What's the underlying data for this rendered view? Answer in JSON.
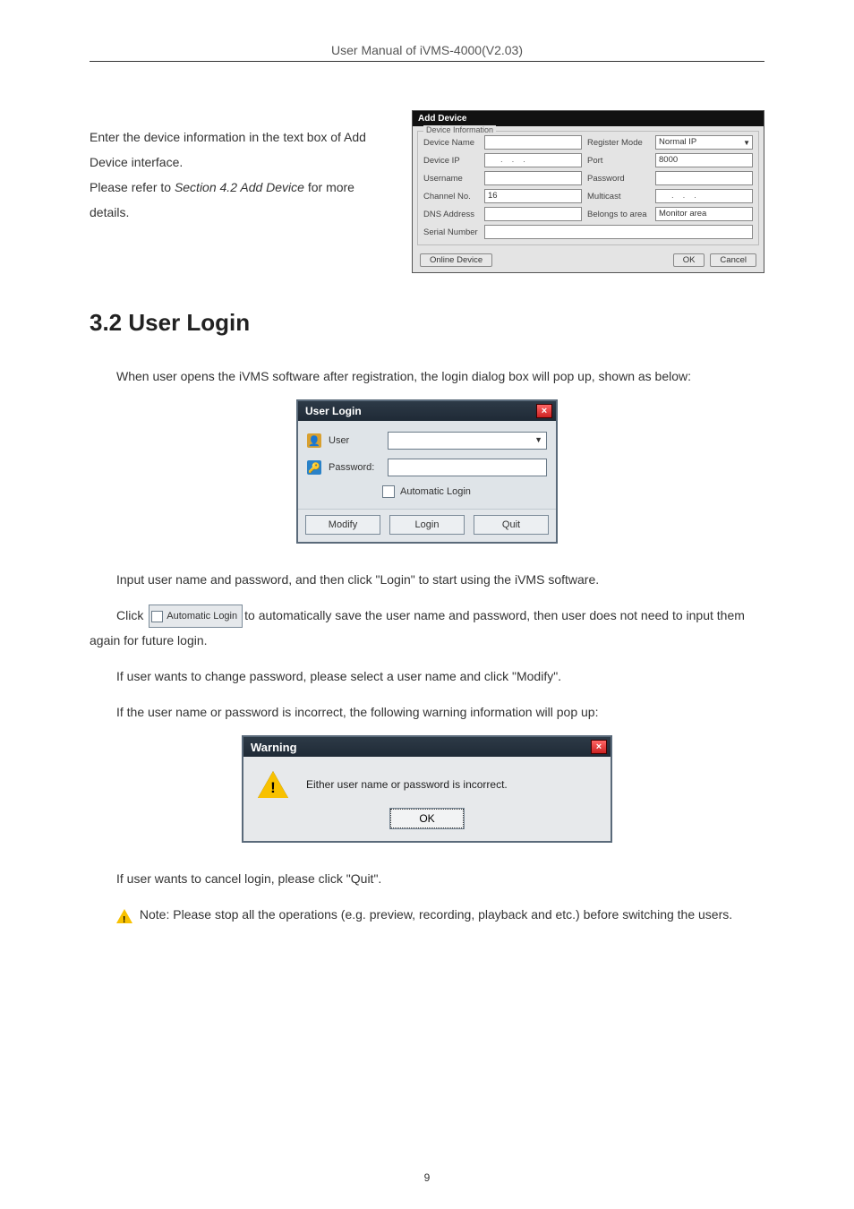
{
  "header": {
    "title": "User Manual of iVMS-4000(V2.03)"
  },
  "intro": {
    "line1": "Enter the device information in the text box of Add Device interface.",
    "line2_pre": "Please refer to ",
    "line2_italic": "Section 4.2 Add Device",
    "line2_post": " for more details."
  },
  "add_device": {
    "win_title": "Add Device",
    "group_label": "Device Information",
    "labels": {
      "device_name": "Device Name",
      "register_mode": "Register Mode",
      "device_ip": "Device IP",
      "port": "Port",
      "username": "Username",
      "password": "Password",
      "channel_no": "Channel No.",
      "multicast": "Multicast",
      "dns_address": "DNS Address",
      "belongs_to": "Belongs to area",
      "serial_number": "Serial Number"
    },
    "values": {
      "register_mode": "Normal IP",
      "port": "8000",
      "channel_no": "16",
      "belongs_to": "Monitor area"
    },
    "buttons": {
      "online": "Online Device",
      "ok": "OK",
      "cancel": "Cancel"
    }
  },
  "section": {
    "heading": "3.2 User Login"
  },
  "para": {
    "p1": "When user opens the iVMS software after registration, the login dialog box will pop up, shown as below:",
    "p2": "Input user name and password, and then click \"Login\" to start using the iVMS software.",
    "p3_pre": "Click ",
    "p3_label": "Automatic Login",
    "p3_post": "to automatically save the user name and password, then user does not need to input them again for future login.",
    "p4": "If user wants to change password, please select a user name and click \"Modify\".",
    "p5": "If the user name or password is incorrect, the following warning information will pop up:",
    "p6": "If user wants to cancel login, please click \"Quit\".",
    "note": " Note: Please stop all the operations (e.g. preview, recording, playback and etc.) before switching the users."
  },
  "user_login": {
    "title": "User Login",
    "user_label": "User",
    "password_label": "Password:",
    "auto_label": "Automatic Login",
    "buttons": {
      "modify": "Modify",
      "login": "Login",
      "quit": "Quit"
    }
  },
  "warning": {
    "title": "Warning",
    "message": "Either user name or password is incorrect.",
    "ok": "OK"
  },
  "page_number": "9"
}
